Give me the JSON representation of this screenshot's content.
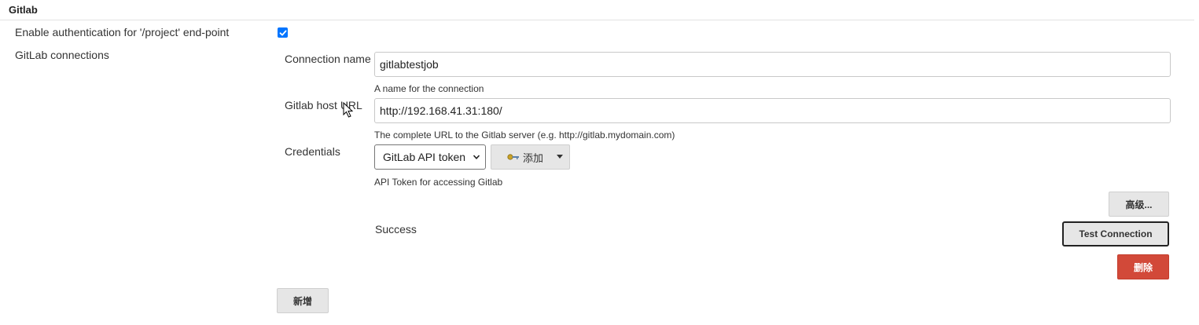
{
  "section": {
    "title": "Gitlab"
  },
  "auth": {
    "label": "Enable authentication for '/project' end-point",
    "checked": true
  },
  "connections": {
    "label": "GitLab connections",
    "connection_name": {
      "label": "Connection name",
      "value": "gitlabtestjob",
      "help": "A name for the connection"
    },
    "host_url": {
      "label": "Gitlab host URL",
      "value": "http://192.168.41.31:180/",
      "help": "The complete URL to the Gitlab server (e.g. http://gitlab.mydomain.com)"
    },
    "credentials": {
      "label": "Credentials",
      "selected": "GitLab API token",
      "add_label": "添加",
      "help": "API Token for accessing Gitlab"
    },
    "advanced_label": "高级...",
    "status_text": "Success",
    "test_label": "Test Connection",
    "delete_label": "删除"
  },
  "add_new_label": "新增",
  "colors": {
    "accent": "#0075ff",
    "danger": "#d24939",
    "button_bg": "#e6e6e6"
  }
}
